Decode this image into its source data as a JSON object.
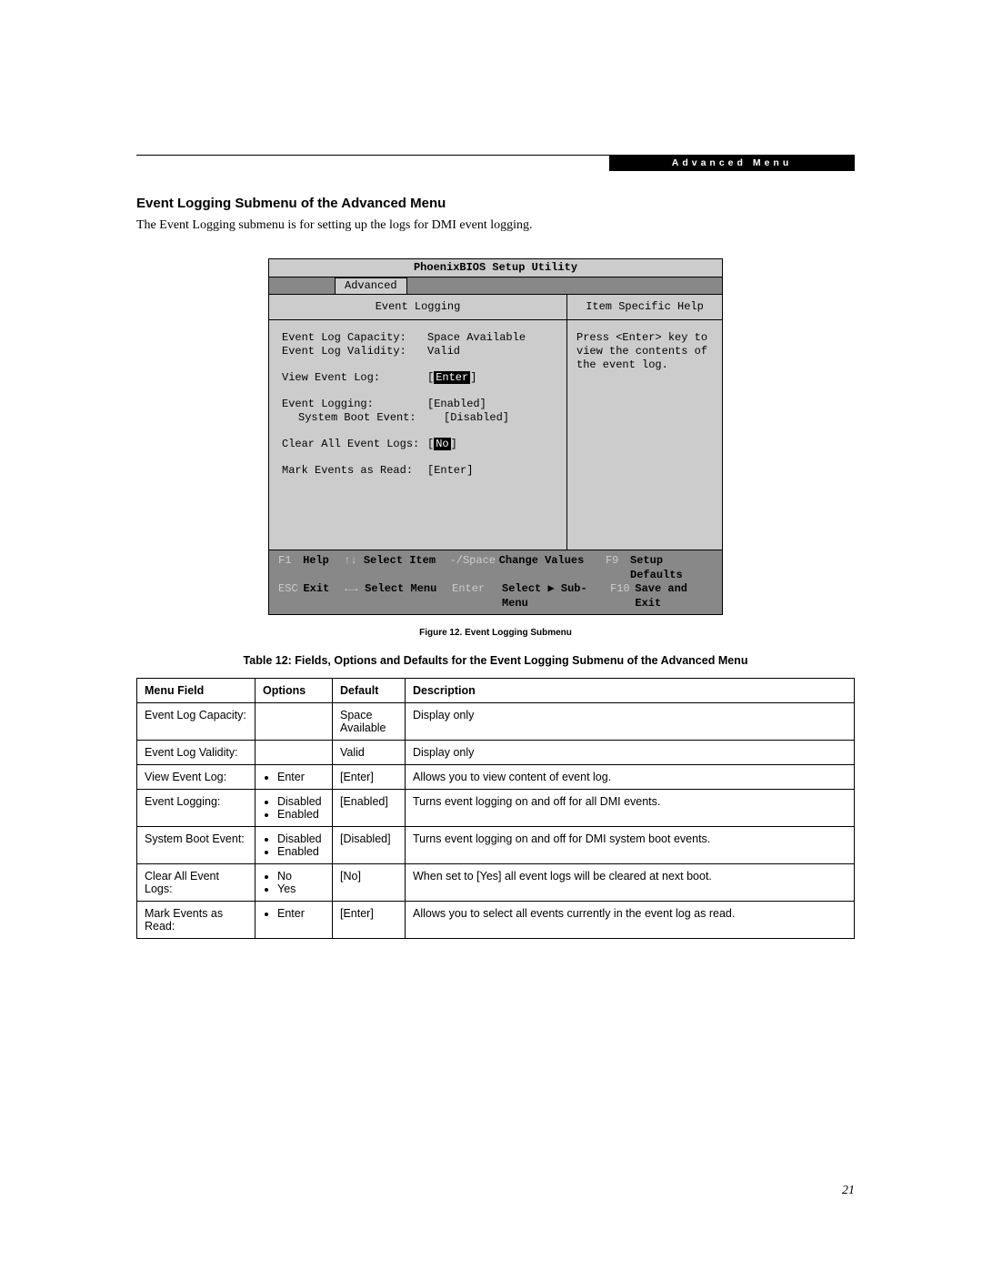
{
  "header": {
    "tab_label": "Advanced Menu"
  },
  "section": {
    "heading": "Event Logging Submenu of the Advanced Menu",
    "intro": "The Event Logging submenu is for setting up the logs for DMI event logging."
  },
  "bios": {
    "title": "PhoenixBIOS Setup Utility",
    "active_tab": "Advanced",
    "left_title": "Event Logging",
    "right_title": "Item Specific Help",
    "help_text": "Press <Enter> key to view the contents of the event log.",
    "rows": [
      {
        "label": "Event Log Capacity:",
        "value": "Space Available",
        "selected": false
      },
      {
        "label": "Event Log Validity:",
        "value": "Valid",
        "selected": false
      },
      {
        "spacer": true
      },
      {
        "label": "View Event Log:",
        "value": "[Enter]",
        "selected": true
      },
      {
        "spacer": true
      },
      {
        "label": "Event Logging:",
        "value": "[Enabled]",
        "selected": false
      },
      {
        "label": "System Boot Event:",
        "value": "[Disabled]",
        "selected": false,
        "indent": true
      },
      {
        "spacer": true
      },
      {
        "label": "Clear All Event Logs:",
        "value": "[No]",
        "selected": true
      },
      {
        "spacer": true
      },
      {
        "label": "Mark Events as Read:",
        "value": "[Enter]",
        "selected": false
      }
    ],
    "footer": {
      "f1": "F1",
      "f1_label": "Help",
      "updown": "↑↓",
      "updown_label": "Select Item",
      "minus": "-/Space",
      "minus_label": "Change Values",
      "f9": "F9",
      "f9_label": "Setup Defaults",
      "esc": "ESC",
      "esc_label": "Exit",
      "lr": "←→",
      "lr_label": "Select Menu",
      "enter": "Enter",
      "enter_label": "Select ▶ Sub-Menu",
      "f10": "F10",
      "f10_label": "Save and Exit"
    }
  },
  "figure_caption": "Figure 12.  Event Logging Submenu",
  "table_caption": "Table 12: Fields, Options and Defaults for the Event Logging Submenu of the Advanced Menu",
  "table": {
    "headers": [
      "Menu Field",
      "Options",
      "Default",
      "Description"
    ],
    "rows": [
      {
        "field": "Event Log Capacity:",
        "options": [],
        "default": "Space Available",
        "desc": "Display only"
      },
      {
        "field": "Event Log Validity:",
        "options": [],
        "default": "Valid",
        "desc": "Display only"
      },
      {
        "field": "View Event Log:",
        "options": [
          "Enter"
        ],
        "default": "[Enter]",
        "desc": "Allows you to view content of event log."
      },
      {
        "field": "Event Logging:",
        "options": [
          "Disabled",
          "Enabled"
        ],
        "default": "[Enabled]",
        "desc": "Turns event logging on and off for all DMI events."
      },
      {
        "field": "System Boot Event:",
        "options": [
          "Disabled",
          "Enabled"
        ],
        "default": "[Disabled]",
        "desc": "Turns event logging on and off for DMI system boot events."
      },
      {
        "field": "Clear All Event Logs:",
        "options": [
          "No",
          "Yes"
        ],
        "default": "[No]",
        "desc": "When set to [Yes] all event logs will be cleared at next boot."
      },
      {
        "field": "Mark Events as Read:",
        "options": [
          "Enter"
        ],
        "default": "[Enter]",
        "desc": "Allows you to select all events currently in the event log as read."
      }
    ]
  },
  "page_number": "21"
}
